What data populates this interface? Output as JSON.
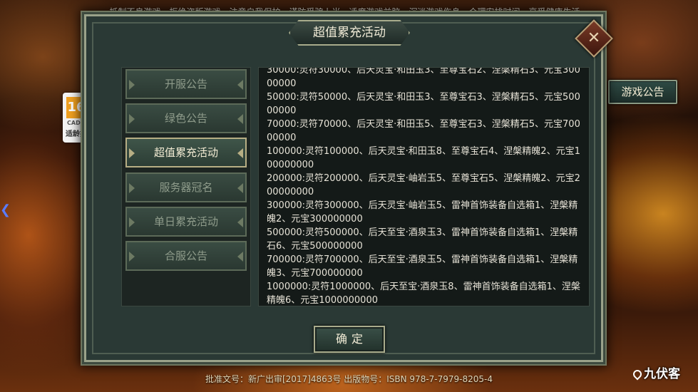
{
  "notice_top": "抵制不良游戏，拒绝盗版游戏。注意自我保护，谨防受骗上当。适度游戏益脑，沉迷游戏伤身。合理安排时间，享受健康生活。",
  "notice_bottom": "批准文号：新广出审[2017]4863号 出版物号：ISBN 978-7-7979-8205-4",
  "watermark": "九伏客",
  "age_badge": {
    "age": "16",
    "org": "CADPA",
    "tip": "适龄提示"
  },
  "external_button": "游戏公告",
  "dialog": {
    "title": "超值累充活动",
    "close_symbol": "✕",
    "confirm_label": "确定",
    "menu": [
      {
        "label": "开服公告",
        "active": false
      },
      {
        "label": "绿色公告",
        "active": false
      },
      {
        "label": "超值累充活动",
        "active": true
      },
      {
        "label": "服务器冠名",
        "active": false
      },
      {
        "label": "单日累充活动",
        "active": false
      },
      {
        "label": "合服公告",
        "active": false
      }
    ],
    "content_lines": [
      "30000:灵符30000、后天灵宝·和田玉3、至尊宝石2、涅槃精石3、元宝300",
      "00000",
      "50000:灵符50000、后天灵宝·和田玉3、至尊宝石3、涅槃精石5、元宝500",
      "00000",
      "70000:灵符70000、后天灵宝·和田玉5、至尊宝石3、涅槃精石5、元宝700",
      "00000",
      "100000:灵符100000、后天灵宝·和田玉8、至尊宝石4、涅槃精魄2、元宝1",
      "00000000",
      "200000:灵符200000、后天灵宝·岫岩玉5、至尊宝石5、涅槃精魄2、元宝2",
      "00000000",
      "300000:灵符300000、后天灵宝·岫岩玉5、雷神首饰装备自选箱1、涅槃精",
      "魄2、元宝300000000",
      "500000:灵符500000、后天至宝·酒泉玉3、雷神首饰装备自选箱1、涅槃精",
      "石6、元宝500000000",
      "700000:灵符700000、后天至宝·酒泉玉5、雷神首饰装备自选箱1、涅槃精",
      "魄3、元宝700000000",
      "1000000:灵符1000000、后天至宝·酒泉玉8、雷神首饰装备自选箱1、涅槃",
      "精魄6、元宝1000000000"
    ]
  }
}
